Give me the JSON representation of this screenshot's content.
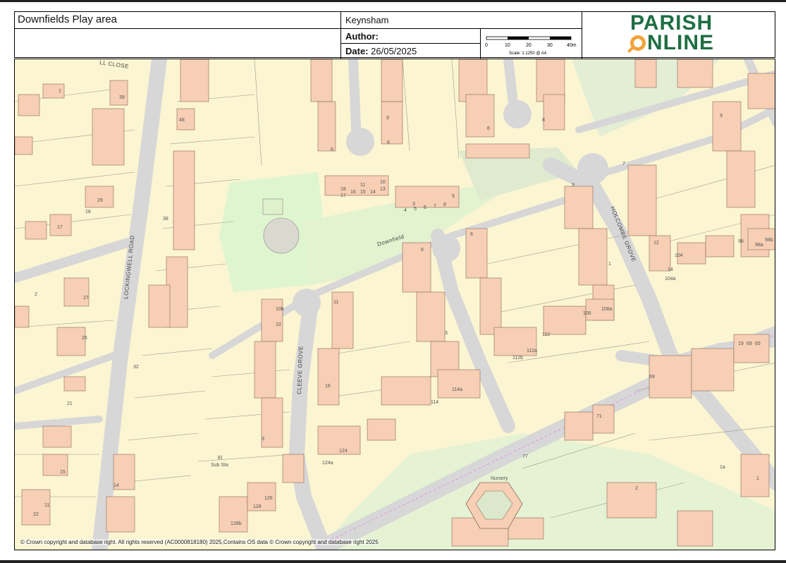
{
  "header": {
    "title": "Downfields Play area",
    "place": "Keynsham",
    "author_label": "Author:",
    "author_value": "",
    "date_label": "Date:",
    "date_value": "26/05/2025",
    "scale": {
      "ticks": [
        "0",
        "10",
        "20",
        "30",
        "40m"
      ],
      "text": "Scale: 1:1250 @ A4"
    },
    "logo": {
      "line1": "PARISH",
      "line2": "NLINE",
      "brand_color": "#1f6e43",
      "accent_color": "#f2a33a"
    }
  },
  "map": {
    "roads": {
      "lockingwell": "LOCKINGWELL ROAD",
      "cleeve": "CLEEVE GROVE",
      "holcombe": "HOLCOMBE GROVE",
      "downfield": "Downfield",
      "close": "LL CLOSE"
    },
    "labels": {
      "nursery": "Nursery",
      "el_sub_1": "El",
      "el_sub_2": "Sub Sta"
    },
    "house_numbers": [
      "1",
      "39",
      "48",
      "6",
      "9",
      "8",
      "6",
      "8",
      "29",
      "18",
      "17",
      "38",
      "2",
      "27",
      "25",
      "32",
      "21",
      "15",
      "14",
      "11",
      "22",
      "12",
      "18",
      "11",
      "10",
      "13",
      "17",
      "16",
      "15",
      "14",
      "3",
      "4",
      "5",
      "6",
      "7",
      "8",
      "9",
      "10b",
      "10",
      "11",
      "3",
      "8",
      "16",
      "6",
      "9",
      "3",
      "1",
      "7",
      "9",
      "12",
      "14",
      "104",
      "98",
      "98a",
      "98b",
      "104a",
      "106",
      "106a",
      "112",
      "112a",
      "112b",
      "114",
      "114a",
      "124",
      "124a",
      "128",
      "126",
      "128b",
      "77",
      "71",
      "69",
      "19",
      "69",
      "65",
      "1",
      "1a",
      "2"
    ],
    "copyright": "© Crown copyright and database right. All rights reserved (AC0000818180) 2025,Contains OS data © Crown copyright and database right 2025",
    "colors": {
      "land": "#fbf5d2",
      "building": "#f7cfb4",
      "road": "#d7d7d7",
      "green": "#dff5cf"
    }
  }
}
